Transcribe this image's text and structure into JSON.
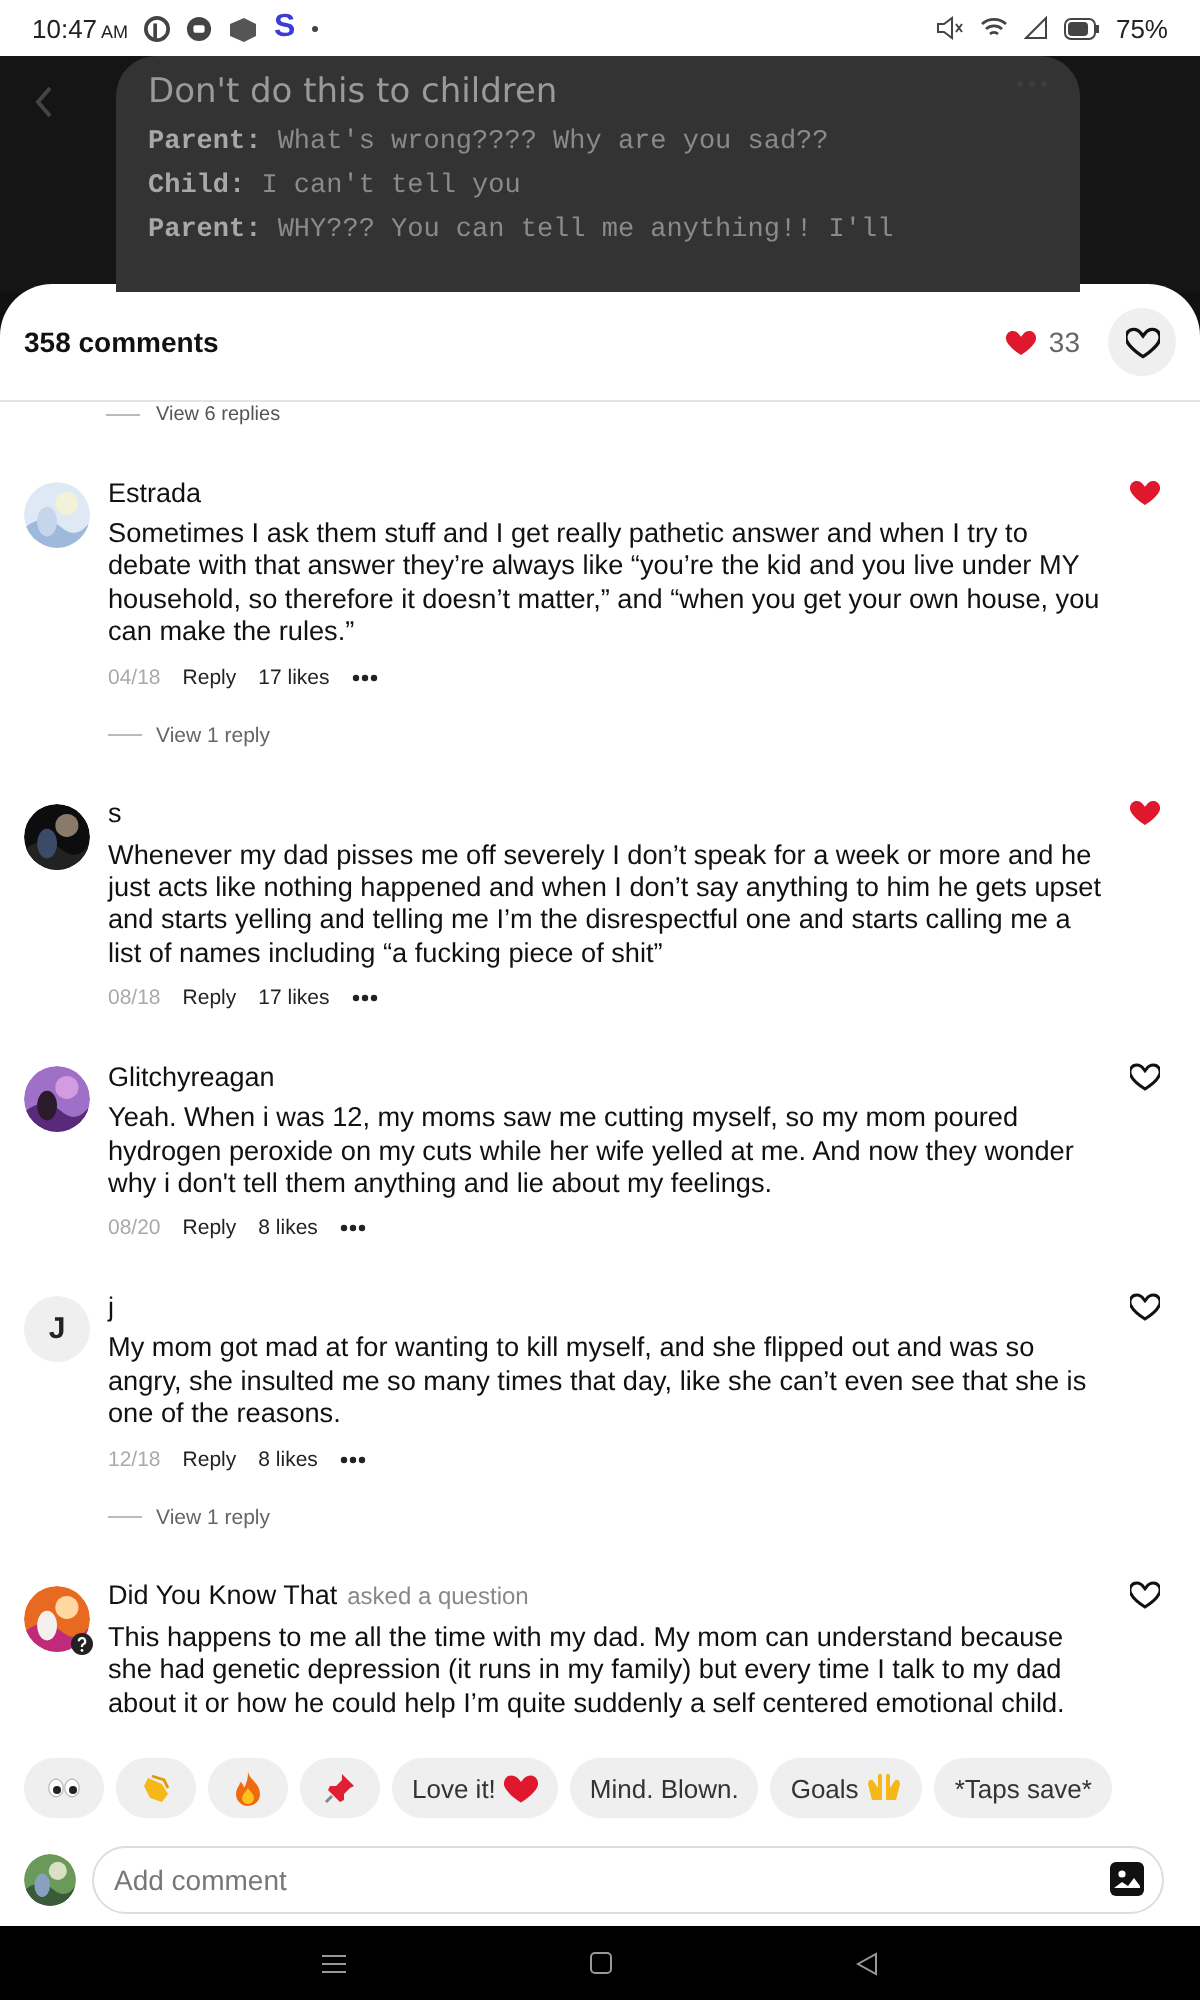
{
  "status_bar": {
    "time": "10:47",
    "meridiem": "AM",
    "app_letter": "S",
    "battery": "75%"
  },
  "post": {
    "title": "Don't do this to children",
    "lines": [
      "**Parent:** What's wrong???? Why are you sad??",
      "**Child:** I can't tell you",
      "**Parent:** WHY??? You can tell me anything!! I'll"
    ]
  },
  "sheet": {
    "comment_count": "358 comments",
    "reaction_count": "33",
    "liked": false,
    "previous_replies": "View 6 replies"
  },
  "comments": [
    {
      "name": "Estrada",
      "text": "Sometimes I ask them stuff and I get really pathetic answer and when I try to debate with that answer they’re always like “you’re the kid and you live under MY household, so therefore it doesn’t matter,” and “when you get your own house, you can make the rules.”",
      "date": "04/18",
      "reply": "Reply",
      "likes": "17 likes",
      "liked": true,
      "replies": "View 1 reply"
    },
    {
      "name": "s",
      "text": "Whenever my dad pisses me off severely I don’t speak for a week or more and he just acts like nothing happened and when I don’t say anything to him he gets upset and starts yelling and telling me I’m the disrespectful one and starts calling me a list of names including “a fucking piece of shit”",
      "date": "08/18",
      "reply": "Reply",
      "likes": "17 likes",
      "liked": true
    },
    {
      "name": "Glitchyreagan",
      "text": "Yeah. When i was 12, my moms saw me cutting myself, so my mom poured hydrogen peroxide on my cuts while her wife yelled at me. And now they wonder why i don't tell them anything and lie about my feelings.",
      "date": "08/20",
      "reply": "Reply",
      "likes": "8 likes",
      "liked": false
    },
    {
      "avatar": {
        "kind": "letter",
        "initial": "J"
      },
      "name": "j",
      "text": "My mom got mad at for wanting to kill myself, and she flipped out and was so angry, she insulted me so many times that day, like she can’t even see that she is one of the reasons.",
      "date": "12/18",
      "reply": "Reply",
      "likes": "8 likes",
      "liked": false,
      "replies": "View 1 reply"
    },
    {
      "name": "Did You Know That",
      "note": "asked a question",
      "text": "This happens to me all the time with my dad. My mom can understand because she had genetic depression (it runs in my family) but every time I talk to my dad about it or how he could help I’m quite suddenly a self centered emotional child.",
      "liked": false
    }
  ],
  "reactions": [
    {
      "kind": "eyes"
    },
    {
      "kind": "clap"
    },
    {
      "kind": "fire"
    },
    {
      "kind": "pin"
    },
    {
      "kind": "heart",
      "label": "Love it!"
    },
    {
      "kind": "plain",
      "label": "Mind. Blown."
    },
    {
      "kind": "hands",
      "label": "Goals"
    },
    {
      "kind": "plain",
      "label": "*Taps save*"
    }
  ],
  "composer": {
    "placeholder": "Add comment"
  }
}
